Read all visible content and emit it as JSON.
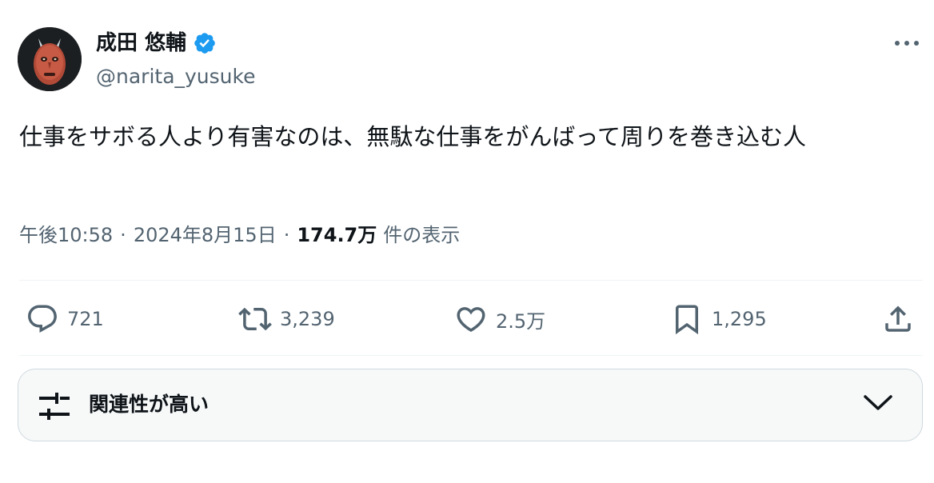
{
  "author": {
    "display_name": "成田 悠輔",
    "handle": "@narita_yusuke",
    "verified": true,
    "avatar_icon": "avatar-mask-image"
  },
  "tweet": {
    "text": "仕事をサボる人より有害なのは、無駄な仕事をがんばって周りを巻き込む人"
  },
  "meta": {
    "time": "午後10:58",
    "separator": "·",
    "date": "2024年8月15日",
    "views_count": "174.7万",
    "views_label": "件の表示"
  },
  "actions": {
    "reply_count": "721",
    "retweet_count": "3,239",
    "like_count": "2.5万",
    "bookmark_count": "1,295"
  },
  "sort": {
    "label": "関連性が高い"
  },
  "colors": {
    "text_primary": "#0f1419",
    "text_secondary": "#536471",
    "verified_blue": "#1d9bf0",
    "border": "#cfd9de",
    "divider": "#eff3f4",
    "sort_bg": "#f7f9f9"
  }
}
